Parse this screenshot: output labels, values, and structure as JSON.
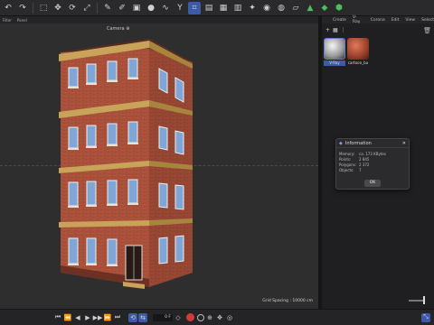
{
  "viewport": {
    "menu": [
      "Filter",
      "Panel"
    ],
    "camera_label": "Camera",
    "camera_suffix": "⊕",
    "grid_spacing": "Grid Spacing : 10000 cm"
  },
  "toolbar_icons": [
    "undo-icon",
    "redo-icon",
    "select-icon",
    "move-icon",
    "rotate-icon",
    "scale-icon",
    "pen-icon",
    "brush-icon",
    "cube-icon",
    "sphere-icon",
    "spline-icon",
    "deformer-icon",
    "light-icon",
    "camera-icon",
    "render-region-icon",
    "render-view-icon",
    "render-settings-icon",
    "film-icon",
    "material-icon",
    "floor-icon",
    "tree-icon",
    "sky-icon",
    "cloud-icon"
  ],
  "right_panel": {
    "menu": [
      "Create",
      "V-Ray",
      "Corona",
      "Edit",
      "View",
      "Select"
    ],
    "materials": [
      {
        "label": "V-Ray",
        "color": "#cfcfcf"
      },
      {
        "label": "cartoon_bu",
        "color": "#b8533d"
      }
    ]
  },
  "info_dialog": {
    "title": "Information",
    "rows": [
      {
        "key": "Memory:",
        "value": "ca. 173 KBytes"
      },
      {
        "key": "Points:",
        "value": "2 845"
      },
      {
        "key": "Polygons:",
        "value": "2 372"
      },
      {
        "key": "Objects:",
        "value": "7"
      }
    ],
    "ok_label": "OK"
  },
  "timeline": {
    "frame_value": "0 F"
  },
  "colors": {
    "accent": "#3c5aa8",
    "brick": "#b2573f",
    "trim": "#c9a35a"
  }
}
